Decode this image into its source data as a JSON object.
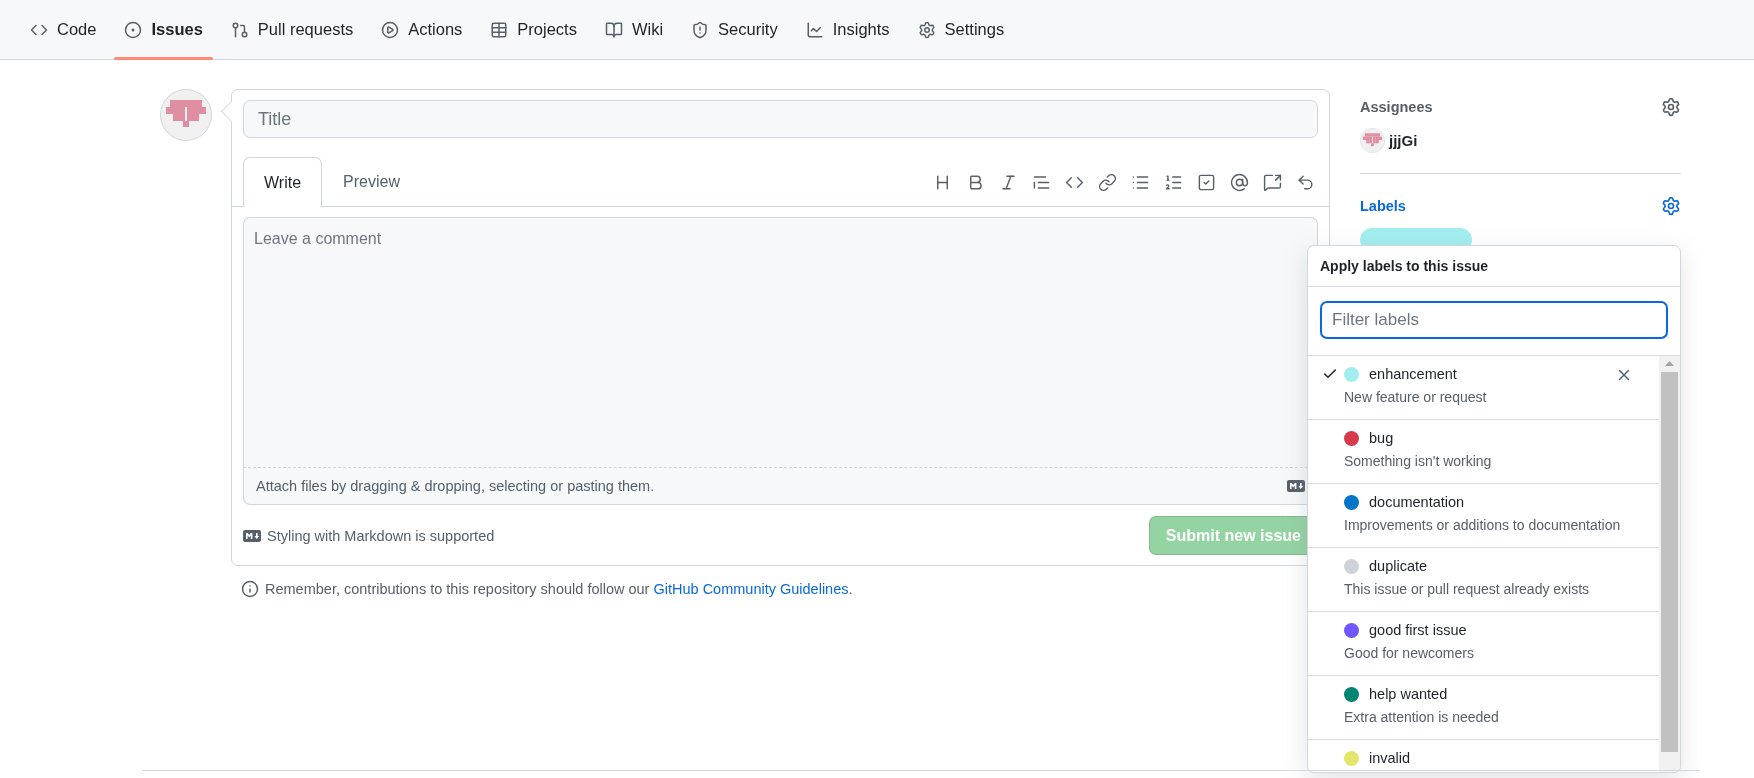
{
  "nav": {
    "tabs": [
      {
        "label": "Code",
        "selected": false
      },
      {
        "label": "Issues",
        "selected": true
      },
      {
        "label": "Pull requests",
        "selected": false
      },
      {
        "label": "Actions",
        "selected": false
      },
      {
        "label": "Projects",
        "selected": false
      },
      {
        "label": "Wiki",
        "selected": false
      },
      {
        "label": "Security",
        "selected": false
      },
      {
        "label": "Insights",
        "selected": false
      },
      {
        "label": "Settings",
        "selected": false
      }
    ]
  },
  "issue_form": {
    "title_placeholder": "Title",
    "tabs": [
      {
        "label": "Write",
        "selected": true
      },
      {
        "label": "Preview",
        "selected": false
      }
    ],
    "comment_placeholder": "Leave a comment",
    "attach_hint": "Attach files by dragging & dropping, selecting or pasting them.",
    "markdown_note": "Styling with Markdown is supported",
    "submit": {
      "label": "Submit new issue",
      "disabled": true
    }
  },
  "guidelines": {
    "text": "Remember, contributions to this repository should follow our",
    "link": "GitHub Community Guidelines",
    "end": "."
  },
  "sidebar": {
    "assignees": {
      "title": "Assignees",
      "users": [
        {
          "name": "jjjGi"
        }
      ]
    },
    "labels": {
      "title": "Labels",
      "applied": [
        {
          "color": "#a2eeef"
        }
      ]
    }
  },
  "label_menu": {
    "title": "Apply labels to this issue",
    "filter_placeholder": "Filter labels",
    "items": [
      {
        "name": "enhancement",
        "description": "New feature or request",
        "color": "#a2eeef",
        "selected": true
      },
      {
        "name": "bug",
        "description": "Something isn't working",
        "color": "#d73a4a",
        "selected": false
      },
      {
        "name": "documentation",
        "description": "Improvements or additions to documentation",
        "color": "#0075ca",
        "selected": false
      },
      {
        "name": "duplicate",
        "description": "This issue or pull request already exists",
        "color": "#cfd3d7",
        "selected": false
      },
      {
        "name": "good first issue",
        "description": "Good for newcomers",
        "color": "#7057ff",
        "selected": false
      },
      {
        "name": "help wanted",
        "description": "Extra attention is needed",
        "color": "#008672",
        "selected": false
      },
      {
        "name": "invalid",
        "color": "#e4e669",
        "selected": false
      }
    ]
  }
}
